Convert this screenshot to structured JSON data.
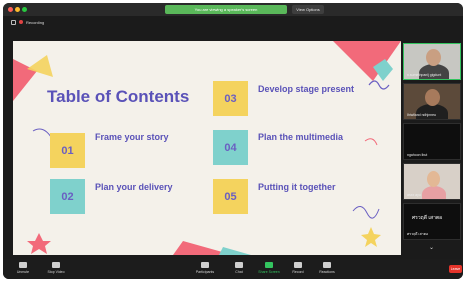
{
  "window": {
    "banner": "You are viewing a speaker's screen",
    "view_options": "View Options",
    "recording": "Recording"
  },
  "slide": {
    "title": "Table of Contents",
    "items": [
      {
        "number": "01",
        "label": "Frame your story",
        "color": "#f4d35e"
      },
      {
        "number": "02",
        "label": "Plan your delivery",
        "color": "#7fd1cc"
      },
      {
        "number": "03",
        "label": "Develop stage present",
        "color": "#f4d35e"
      },
      {
        "number": "04",
        "label": "Plan the multimedia",
        "color": "#7fd1cc"
      },
      {
        "number": "05",
        "label": "Putting it together",
        "color": "#f4d35e"
      }
    ],
    "accent_colors": {
      "pink": "#f26a7a",
      "purple": "#6a5fc2",
      "teal": "#7fd1cc",
      "yellow": "#f4d35e"
    }
  },
  "gallery": {
    "participants": [
      {
        "name": "n.sumethpanij gigdunt"
      },
      {
        "name": "Ihiwlland ndhjnneu"
      },
      {
        "name": "ngahoon lbut"
      },
      {
        "name": "asxx ayu"
      },
      {
        "name": "ศรวฤดี เสาตอ"
      }
    ]
  },
  "toolbar": {
    "items": [
      {
        "label": "Unmute",
        "icon": "microphone-icon"
      },
      {
        "label": "Stop Video",
        "icon": "video-camera-icon"
      },
      {
        "label": "Participants",
        "icon": "people-icon",
        "count": "12"
      },
      {
        "label": "Chat",
        "icon": "chat-icon"
      },
      {
        "label": "Share Screen",
        "icon": "share-screen-icon"
      },
      {
        "label": "Record",
        "icon": "record-icon"
      },
      {
        "label": "Reactions",
        "icon": "smiley-icon"
      }
    ],
    "leave": "Leave"
  }
}
